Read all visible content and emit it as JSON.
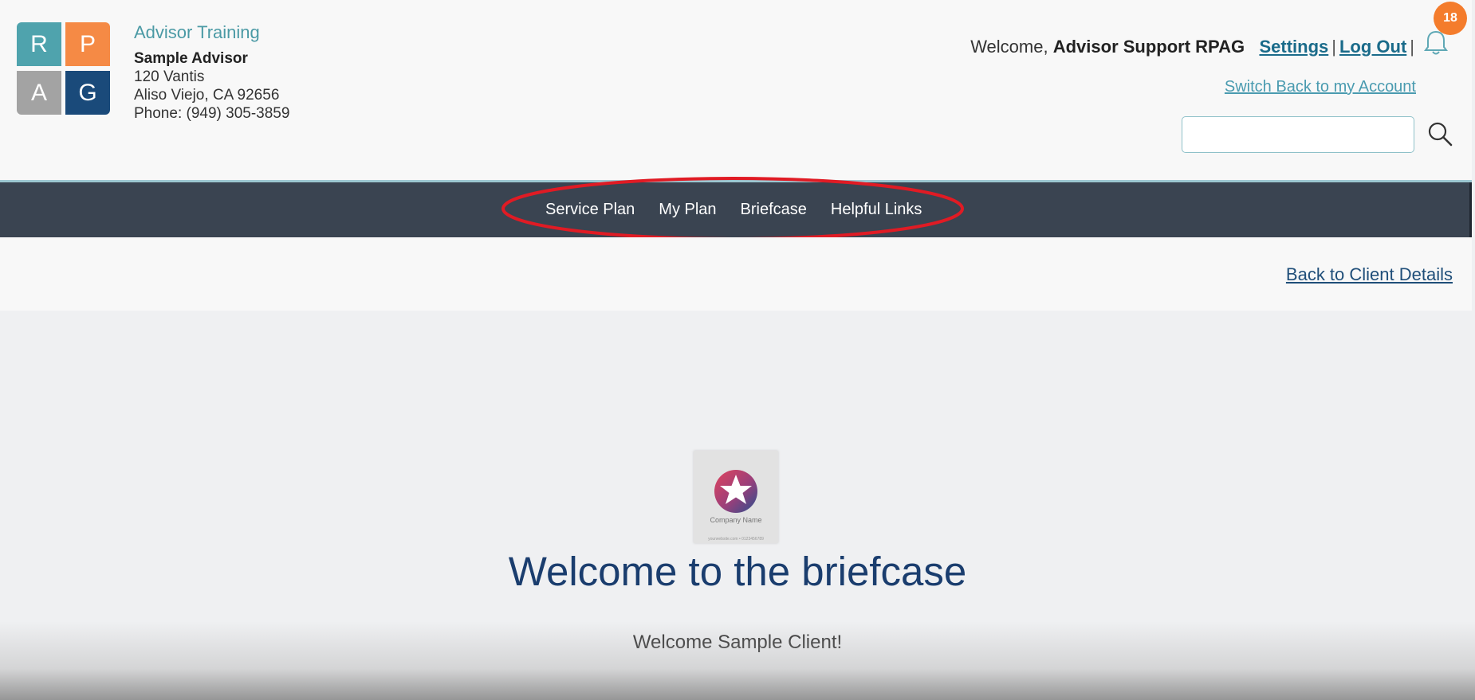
{
  "logo": {
    "tiles": [
      "R",
      "P",
      "A",
      "G"
    ]
  },
  "advisor": {
    "training": "Advisor Training",
    "name": "Sample Advisor",
    "address1": "120 Vantis",
    "address2": "Aliso Viejo, CA 92656",
    "phone": "Phone: (949) 305-3859"
  },
  "user": {
    "welcome_prefix": "Welcome,",
    "user_name": "Advisor Support RPAG",
    "settings_label": "Settings",
    "logout_label": "Log Out",
    "separator": "|",
    "notification_count": "18",
    "switch_back_label": "Switch Back to my Account",
    "search_placeholder": ""
  },
  "nav": {
    "items": [
      "Service Plan",
      "My Plan",
      "Briefcase",
      "Helpful Links"
    ]
  },
  "subbar": {
    "back_label": "Back to Client Details"
  },
  "main": {
    "company_logo_text": "Company Name",
    "company_logo_subtext": "yourwebsite.com • 0123456789",
    "title": "Welcome to the briefcase",
    "subtitle": "Welcome Sample Client!"
  },
  "colors": {
    "nav_bg": "#3a4451",
    "accent_teal": "#4b9aa5",
    "link_blue": "#1a6b8a",
    "badge_orange": "#f47c2c",
    "annotation_red": "#e01b24",
    "title_navy": "#1a3d6e"
  },
  "icons": [
    "bell-icon",
    "search-icon",
    "star-icon"
  ]
}
